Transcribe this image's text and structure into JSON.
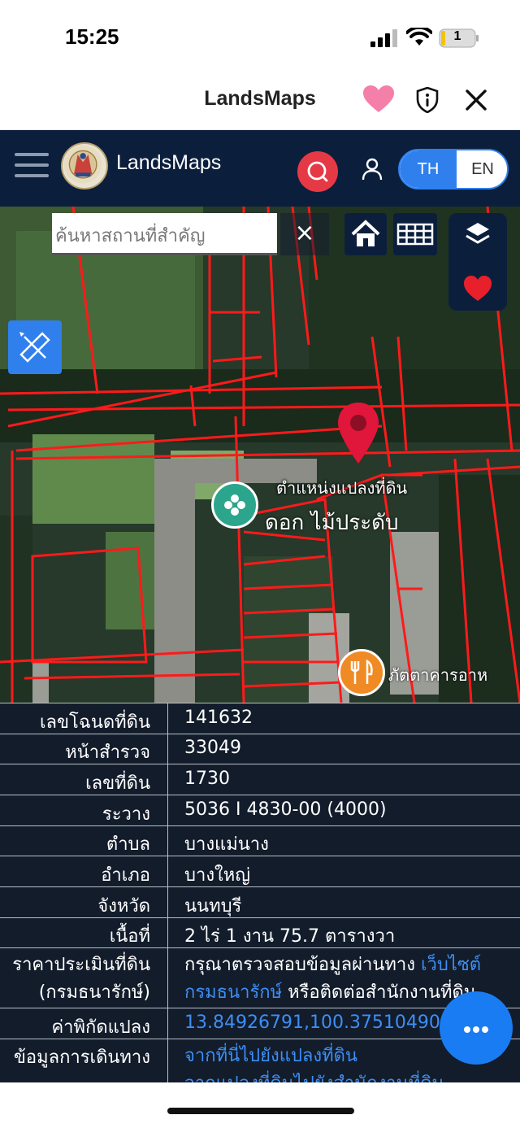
{
  "status_bar": {
    "time": "15:25",
    "battery": "1"
  },
  "browser": {
    "title": "LandsMaps",
    "icons": [
      "heart-icon",
      "shield-icon",
      "close-icon"
    ]
  },
  "app_header": {
    "brand": "LandsMaps",
    "lang_th": "TH",
    "lang_en": "EN",
    "active_lang": "TH"
  },
  "map": {
    "search_placeholder": "ค้นหาสถานที่สำคัญ",
    "clear_symbol": "×",
    "parcel_label": "ตำแหน่งแปลงที่ดิน",
    "poi_label_1": "ดอก ไม้ประดับ",
    "poi_label_2": "ภัตตาคารอาห"
  },
  "parcel_info": {
    "rows": [
      {
        "label": "เลขโฉนดที่ดิน",
        "value": "141632"
      },
      {
        "label": "หน้าสำรวจ",
        "value": "33049"
      },
      {
        "label": "เลขที่ดิน",
        "value": "1730"
      },
      {
        "label": "ระวาง",
        "value": "5036 I 4830-00 (4000)"
      },
      {
        "label": "ตำบล",
        "value": "บางแม่นาง"
      },
      {
        "label": "อำเภอ",
        "value": "บางใหญ่"
      },
      {
        "label": "จังหวัด",
        "value": "นนทบุรี"
      },
      {
        "label": "เนื้อที่",
        "value": "2 ไร่ 1 งาน 75.7 ตารางวา"
      }
    ],
    "price_label_1": "ราคาประเมินที่ดิน",
    "price_label_2": "(กรมธนารักษ์)",
    "price_text_1": "กรุณาตรวจสอบข้อมูลผ่านทาง ",
    "price_link_1": "เว็บไซต์",
    "price_link_2": "กรมธนารักษ์",
    "price_text_2": " หรือติดต่อสำนักงานที่ดิน",
    "coord_label": "ค่าพิกัดแปลง",
    "coord_value": "13.84926791,100.37510490",
    "travel_label": "ข้อมูลการเดินทาง",
    "travel_link_1": "จากที่นี่ไปยังแปลงที่ดิน",
    "travel_link_2": "จากแปลงที่ดินไปยังสำนักงานที่ดิน"
  },
  "colors": {
    "header_bg": "#0b1f3d",
    "accent_blue": "#2f80ed",
    "search_red": "#e63946",
    "parcel_line": "#ff1a1a",
    "link": "#3d8ef5"
  }
}
